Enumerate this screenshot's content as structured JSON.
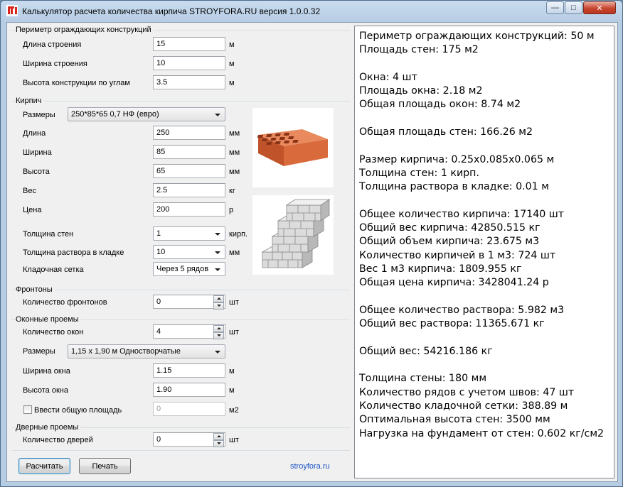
{
  "window": {
    "title": "Калькулятор расчета количества кирпича STROYFORA.RU версия 1.0.0.32",
    "controls": [
      "—",
      "□",
      "✕"
    ]
  },
  "perimeter": {
    "title": "Периметр ограждающих конструкций",
    "length_label": "Длина строения",
    "length_value": "15",
    "length_unit": "м",
    "width_label": "Ширина строения",
    "width_value": "10",
    "width_unit": "м",
    "height_label": "Высота конструкции по углам",
    "height_value": "3.5",
    "height_unit": "м"
  },
  "brick": {
    "title": "Кирпич",
    "size_label": "Размеры",
    "size_value": "250*85*65 0,7 НФ (евро)",
    "length_label": "Длина",
    "length_value": "250",
    "length_unit": "мм",
    "width_label": "Ширина",
    "width_value": "85",
    "width_unit": "мм",
    "height_label": "Высота",
    "height_value": "65",
    "height_unit": "мм",
    "weight_label": "Вес",
    "weight_value": "2.5",
    "weight_unit": "кг",
    "price_label": "Цена",
    "price_value": "200",
    "price_unit": "р",
    "wall_label": "Толщина стен",
    "wall_value": "1",
    "wall_unit": "кирп.",
    "mortar_label": "Толщина раствора в кладке",
    "mortar_value": "10",
    "mortar_unit": "мм",
    "mesh_label": "Кладочная сетка",
    "mesh_value": "Через 5 рядов"
  },
  "gables": {
    "title": "Фронтоны",
    "count_label": "Количество фронтонов",
    "count_value": "0",
    "count_unit": "шт"
  },
  "windows": {
    "title": "Оконные проемы",
    "count_label": "Количество окон",
    "count_value": "4",
    "count_unit": "шт",
    "size_label": "Размеры",
    "size_value": "1,15 х 1,90 м Одностворчатые",
    "width_label": "Ширина окна",
    "width_value": "1.15",
    "width_unit": "м",
    "height_label": "Высота окна",
    "height_value": "1.90",
    "height_unit": "м",
    "area_check_label": "Ввести общую площадь",
    "area_value": "0",
    "area_unit": "м2"
  },
  "doors": {
    "title": "Дверные проемы",
    "count_label": "Количество дверей",
    "count_value": "0",
    "count_unit": "шт"
  },
  "buttons": {
    "calculate": "Расчитать",
    "print": "Печать"
  },
  "site_link": "stroyfora.ru",
  "results": [
    "Периметр ограждающих конструкций: 50 м",
    "Площадь стен: 175 м2",
    "",
    "Окна: 4 шт",
    "Площадь окна: 2.18 м2",
    "Общая площадь окон: 8.74 м2",
    "",
    "Общая площадь стен: 166.26 м2",
    "",
    "Размер кирпича: 0.25x0.085x0.065 м",
    "Толщина стен: 1 кирп.",
    "Толщина раствора в кладке: 0.01 м",
    "",
    "Общее количество кирпича: 17140 шт",
    "Общий вес кирпича: 42850.515 кг",
    "Общий объем кирпича: 23.675 м3",
    "Количество кирпичей в 1 м3: 724 шт",
    "Вес 1 м3 кирпича: 1809.955 кг",
    "Общая цена кирпича: 3428041.24 р",
    "",
    "Общее количество раствора: 5.982 м3",
    "Общий вес раствора: 11365.671 кг",
    "",
    "Общий вес: 54216.186 кг",
    "",
    "Толщина стены: 180 мм",
    "Количество рядов с учетом швов: 47 шт",
    "Количество кладочной сетки: 388.89 м",
    "Оптимальная высота стен: 3500 мм",
    "Нагрузка на фундамент от стен: 0.602 кг/см2"
  ]
}
